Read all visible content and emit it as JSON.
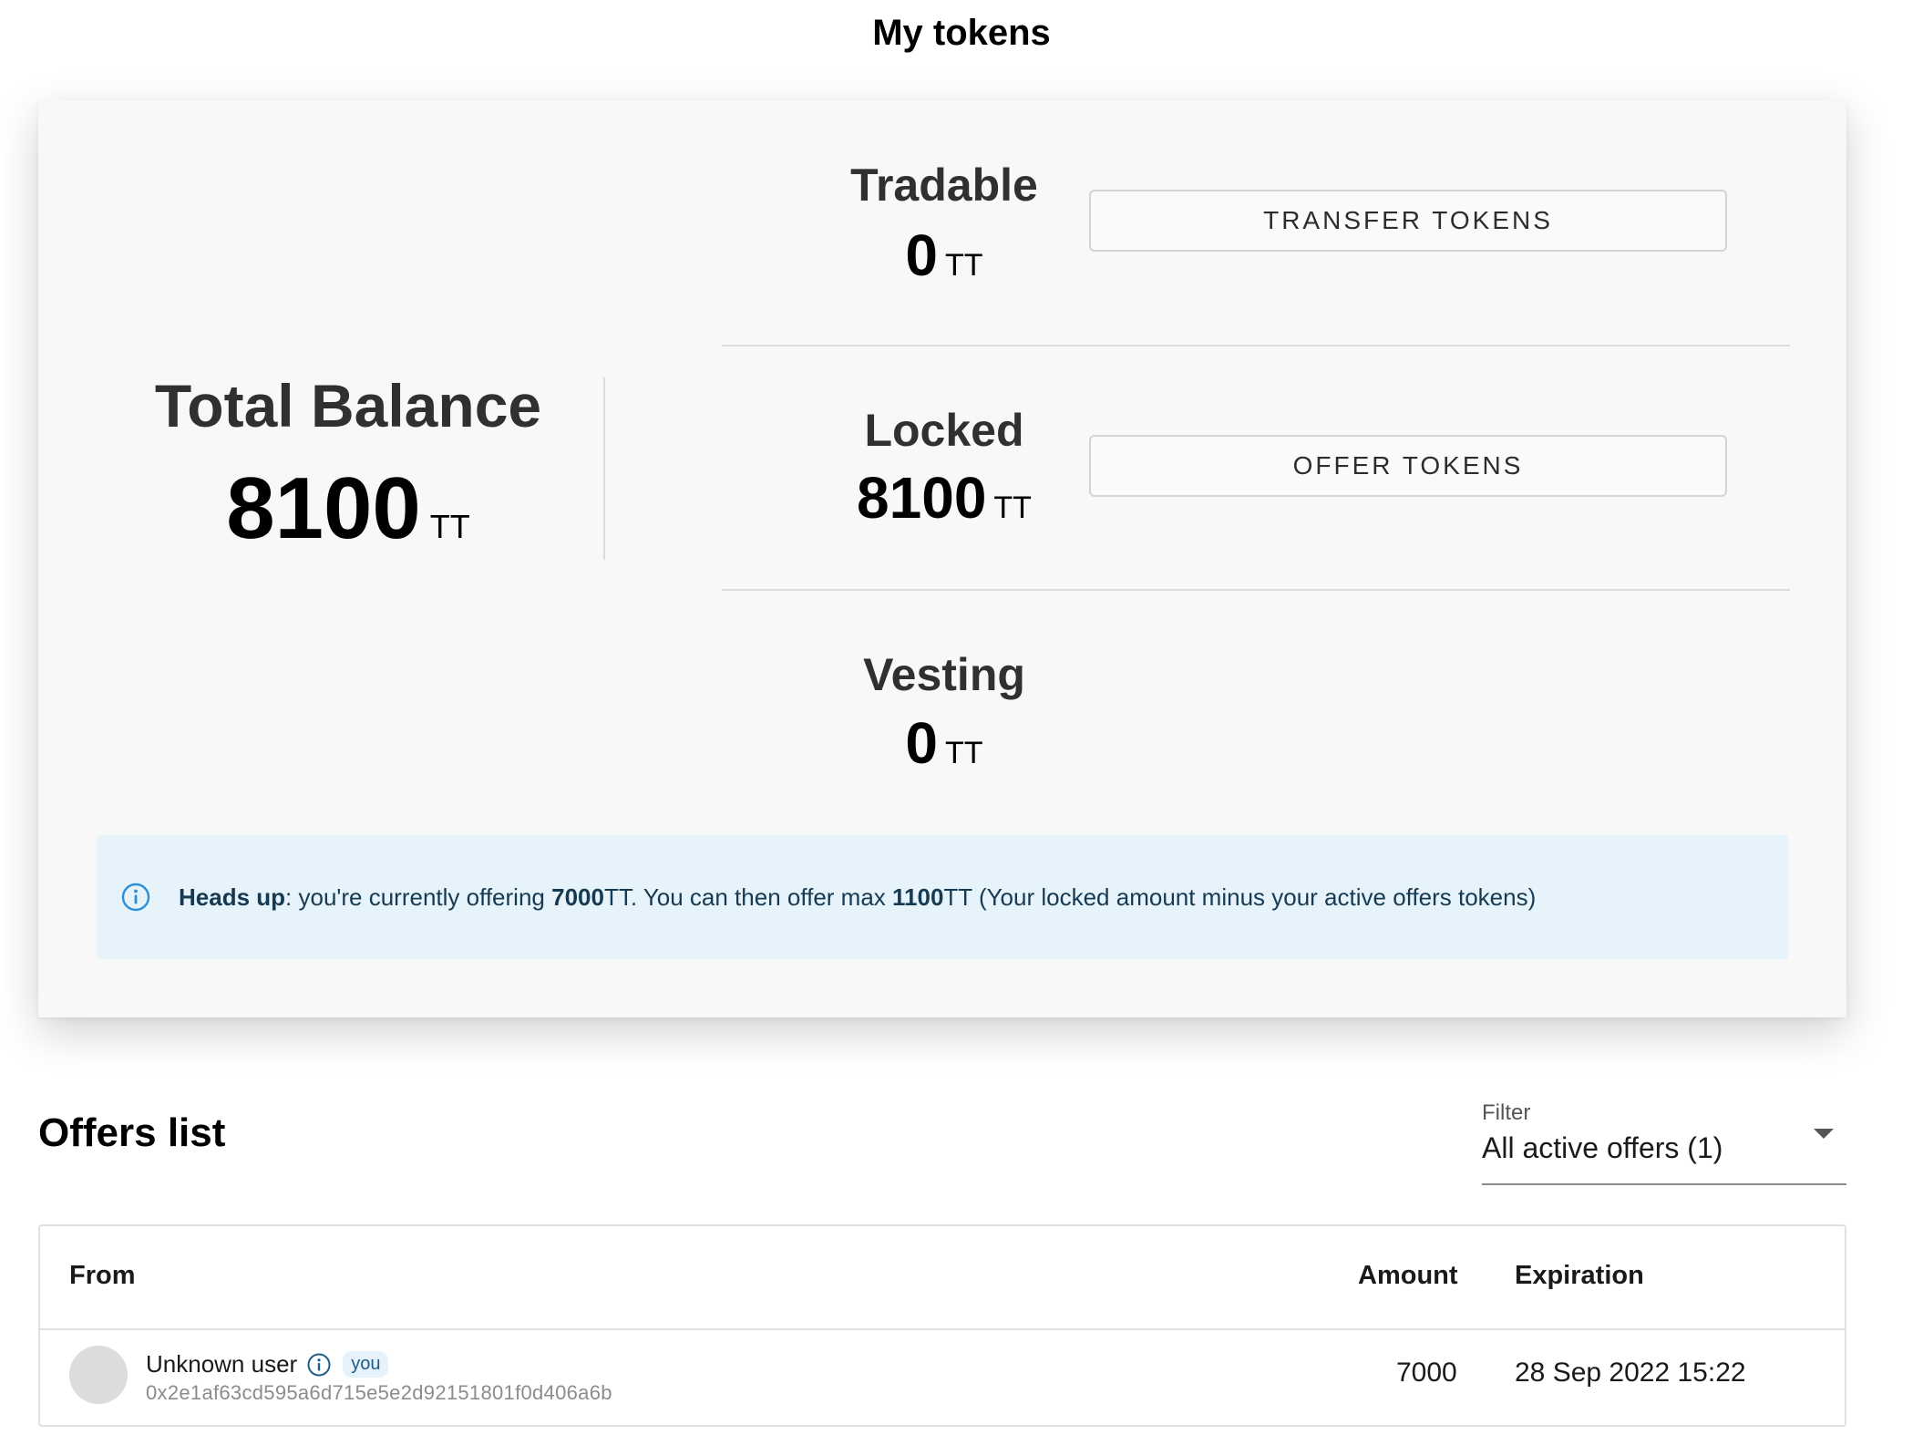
{
  "page": {
    "title": "My tokens"
  },
  "balance": {
    "total_label": "Total Balance",
    "total_value": "8100",
    "unit": "TT",
    "tradable": {
      "label": "Tradable",
      "value": "0",
      "unit": "TT"
    },
    "locked": {
      "label": "Locked",
      "value": "8100",
      "unit": "TT"
    },
    "vesting": {
      "label": "Vesting",
      "value": "0",
      "unit": "TT"
    }
  },
  "actions": {
    "transfer_label": "TRANSFER TOKENS",
    "offer_label": "OFFER TOKENS"
  },
  "alert": {
    "icon": "info-circle-icon",
    "heading": "Heads up",
    "text_1": ": you're currently offering ",
    "offering_amount": "7000",
    "text_2": "TT. You can then offer max ",
    "max_amount": "1100",
    "text_3": "TT (Your locked amount minus your active offers tokens)"
  },
  "offers": {
    "title": "Offers list",
    "filter": {
      "label": "Filter",
      "value": "All active offers (1)"
    },
    "columns": {
      "from": "From",
      "amount": "Amount",
      "expiration": "Expiration"
    },
    "rows": [
      {
        "user": "Unknown user",
        "badge": "you",
        "address": "0x2e1af63cd595a6d715e5e2d92151801f0d406a6b",
        "amount": "7000",
        "expiration": "28 Sep 2022 15:22"
      }
    ]
  },
  "colors": {
    "alert_bg": "#e6f3fb",
    "alert_text": "#163a52",
    "info_blue": "#2e8fd8",
    "card_bg": "#f8f8f8"
  }
}
